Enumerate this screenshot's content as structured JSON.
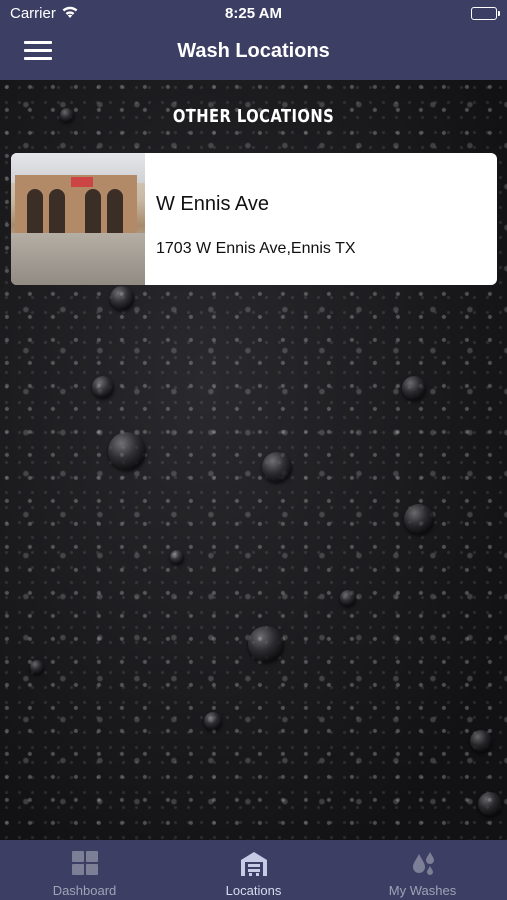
{
  "status_bar": {
    "carrier": "Carrier",
    "time": "8:25 AM"
  },
  "nav": {
    "title": "Wash Locations"
  },
  "section": {
    "title": "OTHER LOCATIONS"
  },
  "locations": [
    {
      "name": "W Ennis Ave",
      "address": "1703 W Ennis Ave,Ennis TX"
    }
  ],
  "tabs": [
    {
      "label": "Dashboard",
      "icon": "dashboard-grid-icon",
      "active": false
    },
    {
      "label": "Locations",
      "icon": "car-wash-building-icon",
      "active": true
    },
    {
      "label": "My Washes",
      "icon": "water-drops-icon",
      "active": false
    }
  ],
  "colors": {
    "bar": "#3c3f63",
    "tab_inactive": "#a0a2b6",
    "tab_active": "#d9dbf0"
  }
}
